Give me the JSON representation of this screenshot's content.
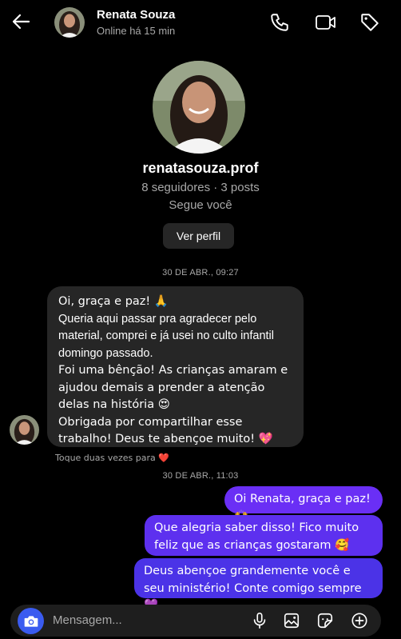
{
  "header": {
    "name": "Renata Souza",
    "status": "Online há 15 min",
    "icons": [
      "back-arrow-icon",
      "phone-icon",
      "video-icon",
      "tag-icon"
    ]
  },
  "profile": {
    "username": "renatasouza.prof",
    "stats": "8 seguidores · 3 posts",
    "follows": "Segue você",
    "view_profile_label": "Ver perfil"
  },
  "timestamps": [
    "30 DE ABR., 09:27",
    "30 DE ABR., 11:03"
  ],
  "incoming": {
    "lines": [
      "Oi, graça e paz! 🙏",
      "Queria aqui passar pra agradecer pelo material, comprei e já usei no culto infantil domingo passado.",
      "Foi uma bênção! As crianças amaram e ajudou demais a prender a atenção delas na história 😍",
      "Obrigada por compartilhar esse trabalho! Deus te abençoe muito! 💖"
    ],
    "hint": "Toque duas vezes para ❤️"
  },
  "outgoing": [
    "Oi Renata, graça e paz! 🙌",
    "Que alegria saber disso! Fico muito feliz que as crianças gostaram 🥰",
    "Deus abençoe grandemente você e seu ministério! Conte comigo sempre 💜"
  ],
  "composer": {
    "placeholder": "Mensagem...",
    "icons": [
      "camera-icon",
      "microphone-icon",
      "image-icon",
      "sticker-icon",
      "plus-icon"
    ]
  },
  "colors": {
    "background": "#000000",
    "incoming_bubble": "#262626",
    "outgoing_bubble_top": "#6a2ff5",
    "outgoing_bubble_bottom": "#4b33e7",
    "camera_button": "#3a5bf0"
  }
}
